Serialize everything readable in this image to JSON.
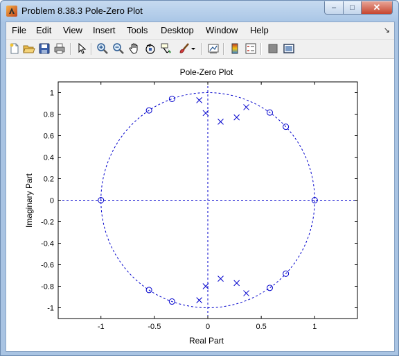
{
  "window": {
    "title": "Problem 8.38.3 Pole-Zero Plot",
    "minimize_glyph": "–",
    "maximize_glyph": "□",
    "close_glyph": "✕"
  },
  "menu": {
    "items": [
      "File",
      "Edit",
      "View",
      "Insert",
      "Tools",
      "Desktop",
      "Window",
      "Help"
    ],
    "dock_arrow": "↘"
  },
  "toolbar": {
    "icons": [
      "new-figure-icon",
      "open-file-icon",
      "save-icon",
      "print-icon",
      "edit-plot-arrow-icon",
      "zoom-in-icon",
      "zoom-out-icon",
      "pan-hand-icon",
      "rotate-3d-icon",
      "data-cursor-icon",
      "brush-icon",
      "brush-dropdown-icon",
      "link-plot-icon",
      "colorbar-icon",
      "legend-icon",
      "hide-plot-tools-icon",
      "show-plot-tools-icon"
    ]
  },
  "chart_data": {
    "type": "scatter",
    "title": "Pole-Zero Plot",
    "xlabel": "Real Part",
    "ylabel": "Imaginary Part",
    "xlim": [
      -1.4,
      1.4
    ],
    "ylim": [
      -1.1,
      1.1
    ],
    "xticks": [
      -1,
      -0.5,
      0,
      0.5,
      1
    ],
    "xtick_labels": [
      "-1",
      "-0.5",
      "0",
      "0.5",
      "1"
    ],
    "yticks": [
      1,
      0.8,
      0.6,
      0.4,
      0.2,
      0,
      -0.2,
      -0.4,
      -0.6,
      -0.8,
      -1
    ],
    "ytick_labels": [
      "1",
      "0.8",
      "0.6",
      "0.4",
      "0.2",
      "0",
      "-0.2",
      "-0.4",
      "-0.6",
      "-0.8",
      "-1"
    ],
    "unit_circle": true,
    "axis_lines": true,
    "grid": false,
    "color": "#0000cc",
    "series": [
      {
        "marker": "o",
        "points": [
          [
            1.0,
            0.0
          ],
          [
            -1.0,
            0.0
          ],
          [
            -0.55,
            0.835
          ],
          [
            -0.55,
            -0.835
          ],
          [
            -0.335,
            0.942
          ],
          [
            -0.335,
            -0.942
          ],
          [
            0.58,
            0.815
          ],
          [
            0.58,
            -0.815
          ],
          [
            0.73,
            0.683
          ],
          [
            0.73,
            -0.683
          ]
        ]
      },
      {
        "marker": "x",
        "points": [
          [
            -0.08,
            0.93
          ],
          [
            -0.08,
            -0.93
          ],
          [
            -0.02,
            0.81
          ],
          [
            -0.02,
            -0.8
          ],
          [
            0.12,
            0.73
          ],
          [
            0.12,
            -0.73
          ],
          [
            0.27,
            0.77
          ],
          [
            0.27,
            -0.77
          ],
          [
            0.36,
            0.865
          ],
          [
            0.36,
            -0.865
          ]
        ]
      }
    ]
  }
}
